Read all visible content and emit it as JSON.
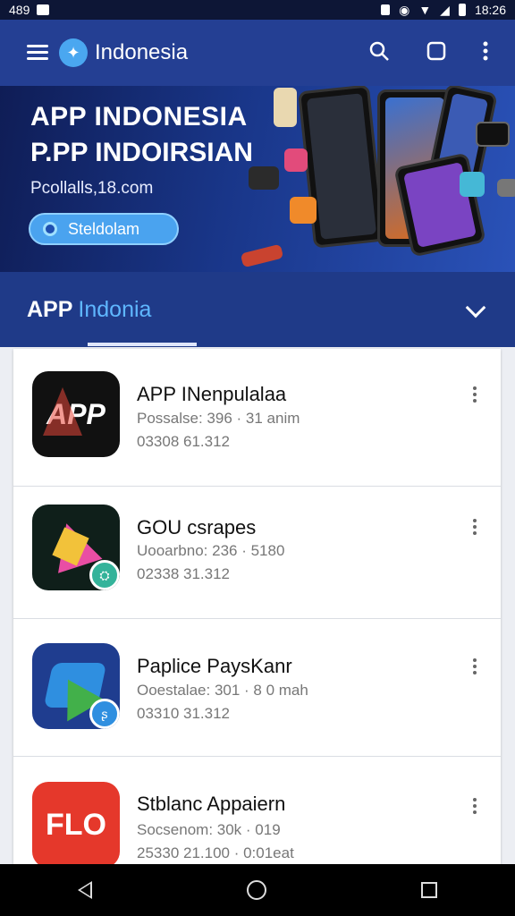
{
  "status_bar": {
    "time_left": "489",
    "time_right": "18:26"
  },
  "app_bar": {
    "title": "Indonesia"
  },
  "hero": {
    "line1": "APP INDONESIA",
    "line2": "P.PP INDOIRSIAN",
    "website": "Pcollalls,18.com",
    "button_label": "Steldolam"
  },
  "tab": {
    "bold": "APP",
    "light": "Indonia"
  },
  "apps": [
    {
      "name": "APP INenpulalaa",
      "meta": "Possalse: 396 · 31 anim",
      "meta2": "03308  61.312",
      "icon_text": "APP",
      "icon_color": "#111111",
      "accent": "#e8473a"
    },
    {
      "name": "GOU csrapes",
      "meta": "Uooarbno: 236 · 5180",
      "meta2": "02338  31.312",
      "icon_text": "",
      "icon_color": "#0f1f1a",
      "accent": "#e94ea4"
    },
    {
      "name": "Paplice PaysKanr",
      "meta": "Ooestalae: 301 · 8 0 mah",
      "meta2": "03310  31.312",
      "icon_text": "",
      "icon_color": "#1f3d8f",
      "accent": "#42b04a"
    },
    {
      "name": "Stblanc Appaiern",
      "meta": "Socsenom: 30k · 019",
      "meta2": "25330  21.100 · 0:01eat",
      "icon_text": "FLO",
      "icon_color": "#e5382b",
      "accent": "#ffffff"
    }
  ]
}
